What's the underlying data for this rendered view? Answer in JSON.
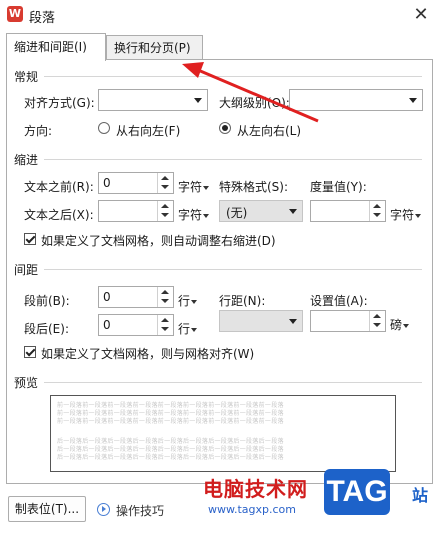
{
  "window": {
    "title": "段落",
    "app_icon": "W",
    "close_glyph": "✕"
  },
  "tabs": [
    {
      "label": "缩进和间距(I)"
    },
    {
      "label": "换行和分页(P)"
    }
  ],
  "general": {
    "section": "常规",
    "align_label": "对齐方式(G):",
    "align_value": "",
    "outline_label": "大纲级别(O):",
    "outline_value": "",
    "direction_label": "方向:",
    "rtl_label": "从右向左(F)",
    "ltr_label": "从左向右(L)",
    "direction_selected": "ltr"
  },
  "indent": {
    "section": "缩进",
    "before_label": "文本之前(R):",
    "before_value": "0",
    "before_unit": "字符",
    "after_label": "文本之后(X):",
    "after_value": "",
    "after_unit": "字符",
    "special_label": "特殊格式(S):",
    "special_value": "(无)",
    "measure_label": "度量值(Y):",
    "measure_value": "",
    "measure_unit": "字符",
    "grid_check_label": "如果定义了文档网格，则自动调整右缩进(D)",
    "grid_checked": true
  },
  "spacing": {
    "section": "间距",
    "before_label": "段前(B):",
    "before_value": "0",
    "before_unit": "行",
    "after_label": "段后(E):",
    "after_value": "0",
    "after_unit": "行",
    "line_label": "行距(N):",
    "line_value": "",
    "setvalue_label": "设置值(A):",
    "setvalue_value": "",
    "setvalue_unit": "磅",
    "grid_check_label": "如果定义了文档网格，则与网格对齐(W)",
    "grid_checked": true
  },
  "preview": {
    "section": "预览",
    "prev_text": "前一段落前一段落前一段落前一段落前一段落前一段落前一段落前一段落前一段落",
    "next_text": "后一段落后一段落后一段落后一段落后一段落后一段落后一段落后一段落后一段落"
  },
  "footer": {
    "tabs_button": "制表位(T)...",
    "tips_label": "操作技巧"
  },
  "watermark": {
    "site_name": "电脑技术网",
    "url": "www.tagxp.com",
    "tag": "TAG",
    "suffix": "站"
  },
  "annotation": {
    "arrow_color": "#e02020"
  }
}
